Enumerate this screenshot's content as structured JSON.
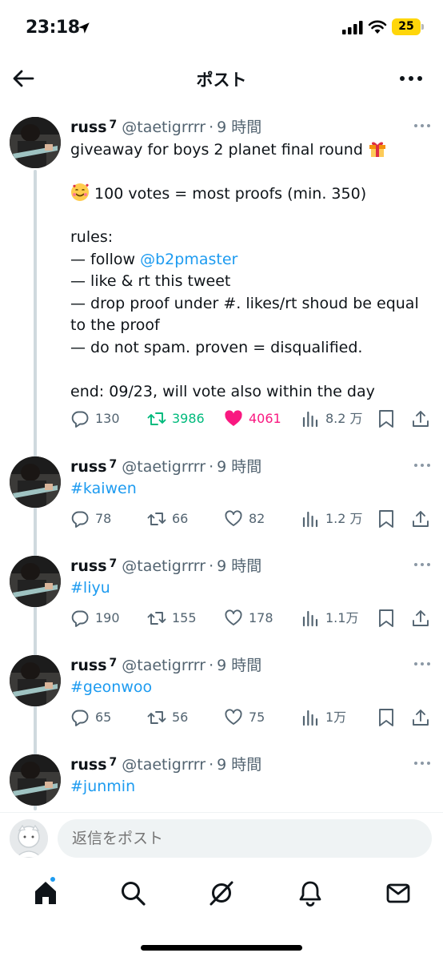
{
  "status_bar": {
    "time": "23:18",
    "battery": "25"
  },
  "header": {
    "title": "ポスト"
  },
  "tweets": [
    {
      "name": "russ",
      "badge": "7",
      "handle": "@taetigrrrr",
      "dot": "·",
      "time": "9 時間",
      "body": {
        "line1": "giveaway for boys 2 planet final round",
        "line3": "100 votes = most proofs (min. 350)",
        "line5": "rules:",
        "line6_prefix": "— follow ",
        "line6_link": "@b2pmaster",
        "line7": "— like & rt this tweet",
        "line8": "— drop proof under #. likes/rt shoud be equal",
        "line9": "to the proof",
        "line10": "— do not spam. proven = disqualified.",
        "line12": "end: 09/23, will vote also within the day"
      },
      "emoji_gift": "gift-emoji",
      "emoji_smile": "smiling-face-with-hearts-emoji",
      "replies": "130",
      "retweets": "3986",
      "likes": "4061",
      "views": "8.2 万",
      "retweeted": true,
      "liked": true
    },
    {
      "name": "russ",
      "badge": "7",
      "handle": "@taetigrrrr",
      "dot": "·",
      "time": "9 時間",
      "hashtag": "#kaiwen",
      "replies": "78",
      "retweets": "66",
      "likes": "82",
      "views": "1.2 万"
    },
    {
      "name": "russ",
      "badge": "7",
      "handle": "@taetigrrrr",
      "dot": "·",
      "time": "9 時間",
      "hashtag": "#liyu",
      "replies": "190",
      "retweets": "155",
      "likes": "178",
      "views": "1.1万"
    },
    {
      "name": "russ",
      "badge": "7",
      "handle": "@taetigrrrr",
      "dot": "·",
      "time": "9 時間",
      "hashtag": "#geonwoo",
      "replies": "65",
      "retweets": "56",
      "likes": "75",
      "views": "1万"
    },
    {
      "name": "russ",
      "badge": "7",
      "handle": "@taetigrrrr",
      "dot": "·",
      "time": "9 時間",
      "hashtag": "#junmin"
    }
  ],
  "reply_bar": {
    "placeholder": "返信をポスト"
  },
  "nav": {
    "items": [
      "home-icon",
      "search-icon",
      "grok-icon",
      "notifications-icon",
      "messages-icon"
    ]
  },
  "colors": {
    "link": "#1d9bf0",
    "retweet": "#00ba7c",
    "like": "#f91880",
    "muted": "#536471"
  }
}
